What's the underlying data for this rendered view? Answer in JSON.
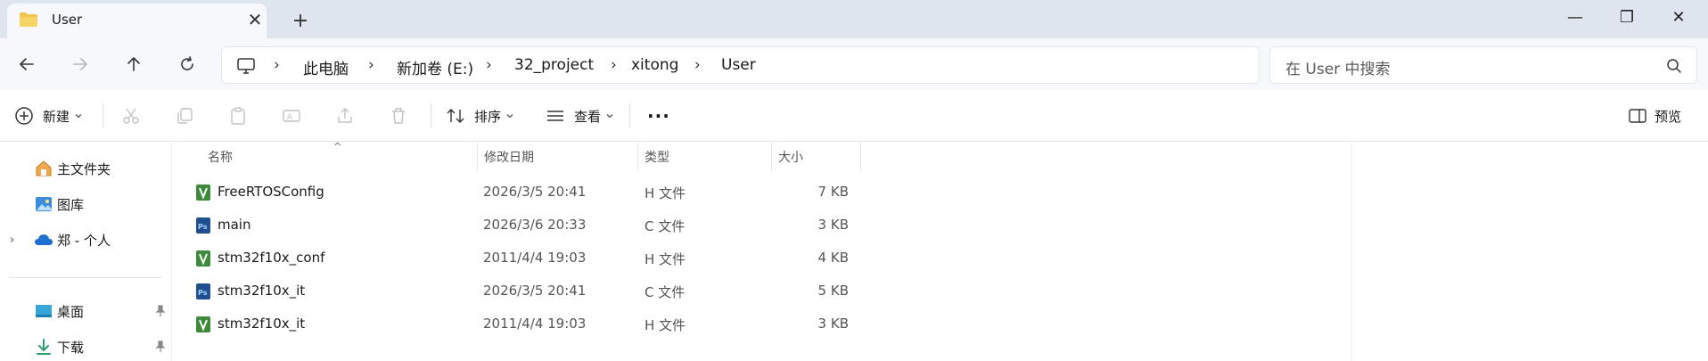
{
  "tab": {
    "title": "User",
    "close_icon": "close-icon",
    "new_tab_icon": "plus-icon"
  },
  "window": {
    "minimize": "—",
    "maximize": "❐",
    "close": "✕"
  },
  "nav": {
    "back": "←",
    "forward": "→",
    "up": "↑",
    "refresh": "⟳",
    "breadcrumb": [
      "此电脑",
      "新加卷 (E:)",
      "32_project",
      "xitong",
      "User"
    ],
    "separator": "›",
    "search_placeholder": "在 User 中搜索"
  },
  "commands": {
    "new_label": "新建",
    "sort_label": "排序",
    "view_label": "查看",
    "more_label": "···",
    "preview_label": "预览"
  },
  "sidebar": {
    "items": [
      {
        "label": "主文件夹",
        "icon": "home-icon"
      },
      {
        "label": "图库",
        "icon": "gallery-icon"
      },
      {
        "label": "郑 - 个人",
        "icon": "onedrive-cloud-icon"
      },
      {
        "label": "桌面",
        "icon": "desktop-icon"
      },
      {
        "label": "下载",
        "icon": "download-icon"
      }
    ]
  },
  "columns": {
    "name": "名称",
    "date": "修改日期",
    "type": "类型",
    "size": "大小"
  },
  "files": [
    {
      "name": "FreeRTOSConfig",
      "date": "2026/3/5 20:41",
      "type": "H 文件",
      "size": "7 KB",
      "icon": "h-file-icon"
    },
    {
      "name": "main",
      "date": "2026/3/6 20:33",
      "type": "C 文件",
      "size": "3 KB",
      "icon": "c-file-icon"
    },
    {
      "name": "stm32f10x_conf",
      "date": "2011/4/4 19:03",
      "type": "H 文件",
      "size": "4 KB",
      "icon": "h-file-icon"
    },
    {
      "name": "stm32f10x_it",
      "date": "2026/3/5 20:41",
      "type": "C 文件",
      "size": "5 KB",
      "icon": "c-file-icon"
    },
    {
      "name": "stm32f10x_it",
      "date": "2011/4/4 19:03",
      "type": "H 文件",
      "size": "3 KB",
      "icon": "h-file-icon"
    }
  ],
  "colors": {
    "accent": "#1e6fd0",
    "tabbar": "#dfe5ee",
    "navbar": "#f6f8fb",
    "h_icon": "#3d8a3a",
    "c_icon": "#1f4f8e"
  }
}
